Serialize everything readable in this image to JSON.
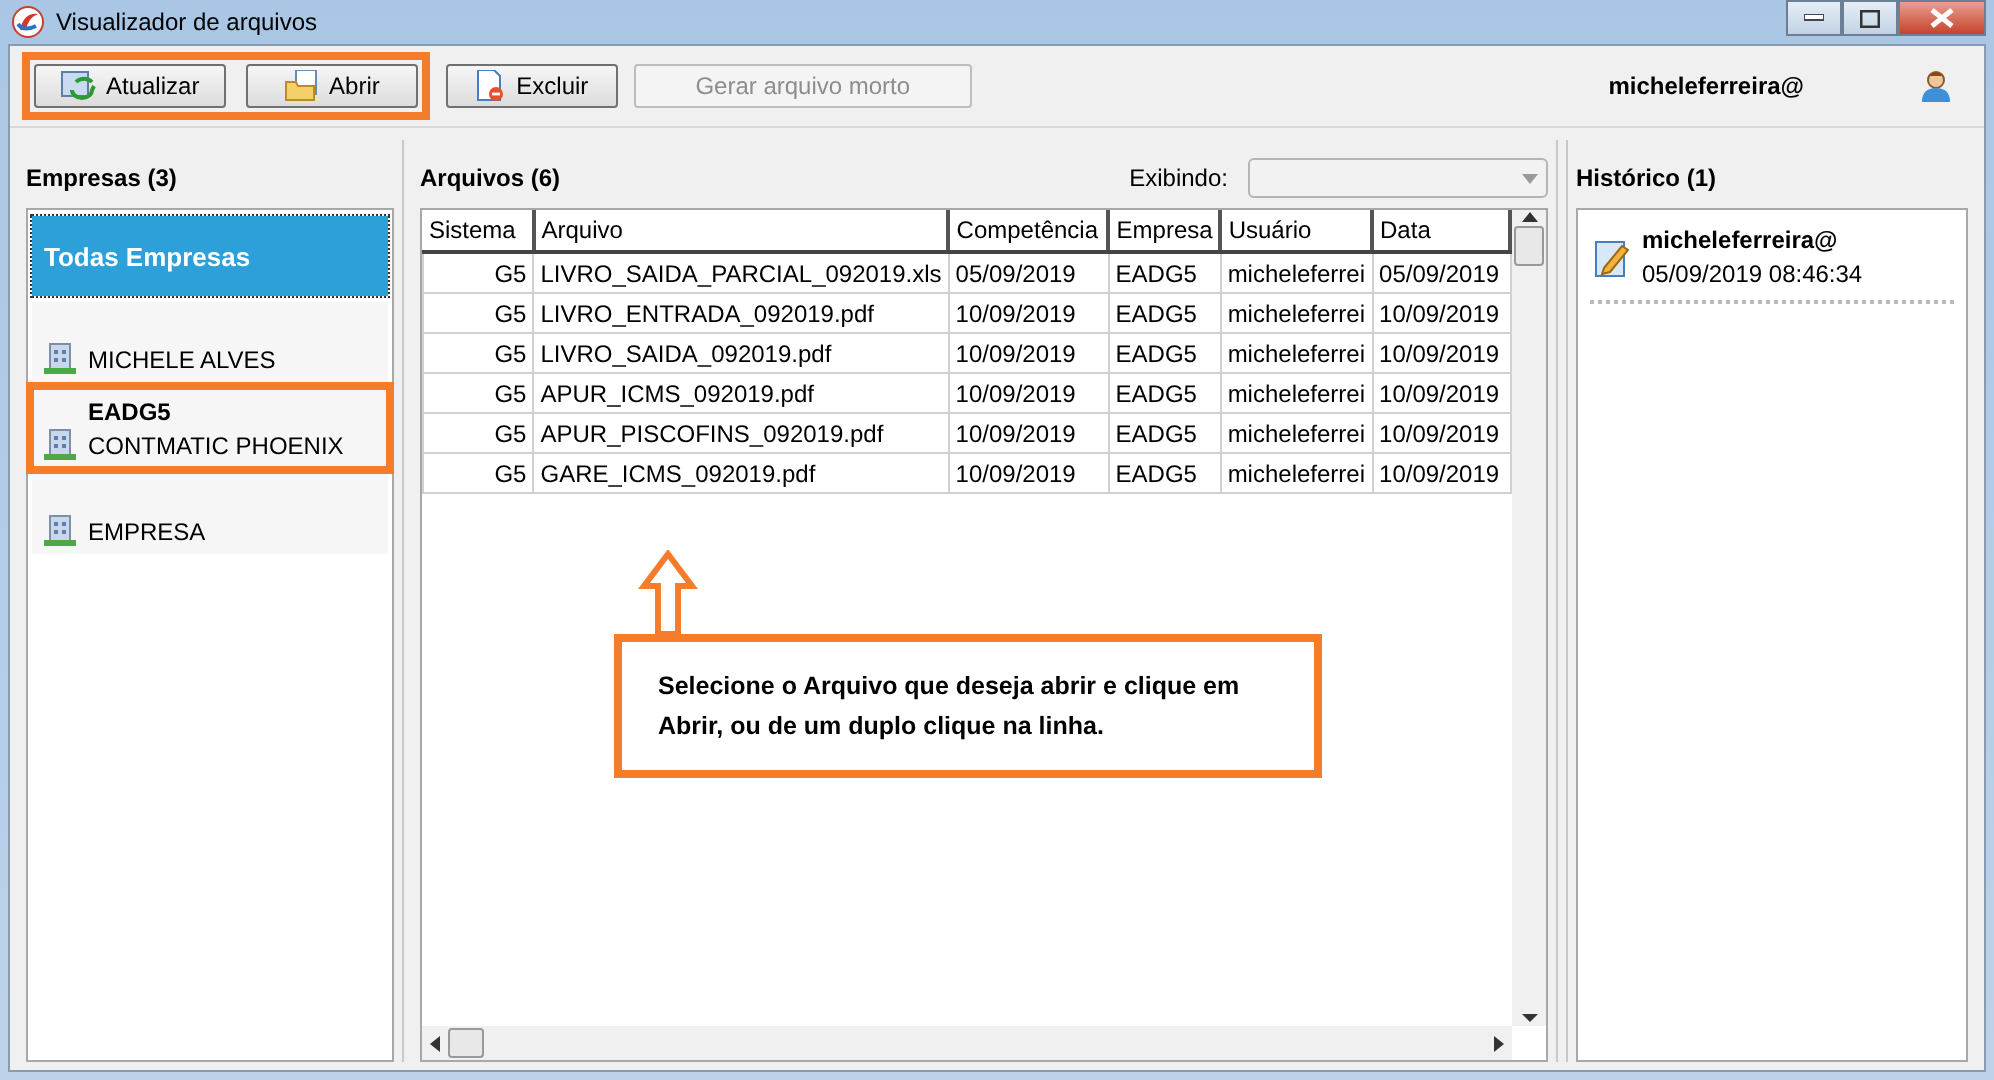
{
  "window": {
    "title": "Visualizador de arquivos"
  },
  "toolbar": {
    "buttons": [
      {
        "label": "Atualizar",
        "kind": "refresh",
        "disabled": false,
        "highlighted": true
      },
      {
        "label": "Abrir",
        "kind": "open",
        "disabled": false,
        "highlighted": true
      },
      {
        "label": "Excluir",
        "kind": "delete",
        "disabled": false,
        "highlighted": false
      },
      {
        "label": "Gerar arquivo morto",
        "kind": "plain",
        "disabled": true,
        "highlighted": false
      }
    ],
    "user": "micheleferreira@"
  },
  "companies": {
    "title": "Empresas (3)",
    "items": [
      {
        "kind": "all",
        "title": "Todas Empresas",
        "selected": true,
        "highlighted": false
      },
      {
        "kind": "company",
        "name": "MICHELE ALVES",
        "selected": false,
        "highlighted": false
      },
      {
        "kind": "company",
        "title": "EADG5",
        "name": "CONTMATIC PHOENIX",
        "selected": false,
        "highlighted": true
      },
      {
        "kind": "company",
        "name": "EMPRESA",
        "selected": false,
        "highlighted": false
      }
    ]
  },
  "files": {
    "title": "Arquivos (6)",
    "filter_label": "Exibindo:",
    "columns": [
      "Sistema",
      "Arquivo",
      "Competência",
      "Empresa",
      "Usuário",
      "Data"
    ],
    "rows": [
      [
        "G5",
        "LIVRO_SAIDA_PARCIAL_092019.xls",
        "05/09/2019",
        "EADG5",
        "micheleferrei",
        "05/09/2019"
      ],
      [
        "G5",
        "LIVRO_ENTRADA_092019.pdf",
        "10/09/2019",
        "EADG5",
        "micheleferrei",
        "10/09/2019"
      ],
      [
        "G5",
        "LIVRO_SAIDA_092019.pdf",
        "10/09/2019",
        "EADG5",
        "micheleferrei",
        "10/09/2019"
      ],
      [
        "G5",
        "APUR_ICMS_092019.pdf",
        "10/09/2019",
        "EADG5",
        "micheleferrei",
        "10/09/2019"
      ],
      [
        "G5",
        "APUR_PISCOFINS_092019.pdf",
        "10/09/2019",
        "EADG5",
        "micheleferrei",
        "10/09/2019"
      ],
      [
        "G5",
        "GARE_ICMS_092019.pdf",
        "10/09/2019",
        "EADG5",
        "micheleferrei",
        "10/09/2019"
      ]
    ],
    "callout": "Selecione o Arquivo que deseja abrir e clique em Abrir, ou de um duplo clique na linha."
  },
  "history": {
    "title": "Histórico (1)",
    "entries": [
      {
        "user": "micheleferreira@",
        "time": "05/09/2019 08:46:34"
      }
    ]
  }
}
